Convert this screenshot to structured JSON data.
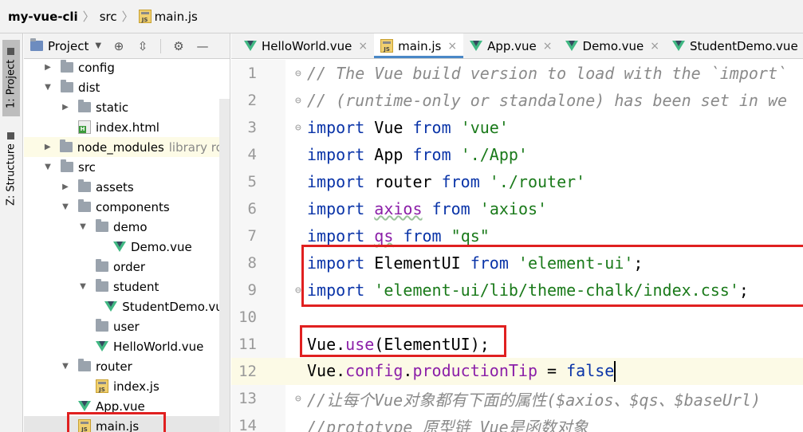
{
  "breadcrumb": {
    "project": "my-vue-cli",
    "folder": "src",
    "file": "main.js"
  },
  "toolstrip": {
    "project_tab": "1: Project",
    "structure_tab": "Z: Structure"
  },
  "project_panel": {
    "title": "Project",
    "tree": [
      {
        "label": "config",
        "type": "folder",
        "state": "collapsed",
        "depth": 0
      },
      {
        "label": "dist",
        "type": "folder",
        "state": "expanded",
        "depth": 0
      },
      {
        "label": "static",
        "type": "folder",
        "state": "collapsed",
        "depth": 1
      },
      {
        "label": "index.html",
        "type": "html",
        "state": "none",
        "depth": 1
      },
      {
        "label": "node_modules",
        "note": "library roo",
        "type": "folder",
        "state": "collapsed",
        "depth": 0,
        "highlight": true
      },
      {
        "label": "src",
        "type": "folder",
        "state": "expanded",
        "depth": 0
      },
      {
        "label": "assets",
        "type": "folder",
        "state": "collapsed",
        "depth": 1
      },
      {
        "label": "components",
        "type": "folder",
        "state": "expanded",
        "depth": 1
      },
      {
        "label": "demo",
        "type": "folder",
        "state": "expanded",
        "depth": 2
      },
      {
        "label": "Demo.vue",
        "type": "vue",
        "state": "none",
        "depth": 3
      },
      {
        "label": "order",
        "type": "folder",
        "state": "none",
        "depth": 2
      },
      {
        "label": "student",
        "type": "folder",
        "state": "expanded",
        "depth": 2
      },
      {
        "label": "StudentDemo.vue",
        "type": "vue",
        "state": "none",
        "depth": 3
      },
      {
        "label": "user",
        "type": "folder",
        "state": "none",
        "depth": 2
      },
      {
        "label": "HelloWorld.vue",
        "type": "vue",
        "state": "none",
        "depth": 2
      },
      {
        "label": "router",
        "type": "folder",
        "state": "expanded",
        "depth": 1
      },
      {
        "label": "index.js",
        "type": "js",
        "state": "none",
        "depth": 2
      },
      {
        "label": "App.vue",
        "type": "vue",
        "state": "none",
        "depth": 1
      },
      {
        "label": "main.js",
        "type": "js",
        "state": "none",
        "depth": 1,
        "selected": true
      }
    ]
  },
  "tabs": [
    {
      "label": "HelloWorld.vue",
      "type": "vue",
      "active": false,
      "closable": true
    },
    {
      "label": "main.js",
      "type": "js",
      "active": true,
      "closable": true
    },
    {
      "label": "App.vue",
      "type": "vue",
      "active": false,
      "closable": true
    },
    {
      "label": "Demo.vue",
      "type": "vue",
      "active": false,
      "closable": true
    },
    {
      "label": "StudentDemo.vue",
      "type": "vue",
      "active": false,
      "closable": false
    }
  ],
  "editor": {
    "lines": [
      {
        "n": "1",
        "fold": true,
        "tokens": [
          [
            "cm",
            "// The Vue build version to load with the `import`"
          ]
        ]
      },
      {
        "n": "2",
        "fold": true,
        "tokens": [
          [
            "cm",
            "// (runtime-only or standalone) has been set in we"
          ]
        ]
      },
      {
        "n": "3",
        "fold": true,
        "tokens": [
          [
            "kw",
            "import"
          ],
          [
            "",
            " Vue "
          ],
          [
            "kw",
            "from"
          ],
          [
            "",
            " "
          ],
          [
            "str",
            "'vue'"
          ]
        ]
      },
      {
        "n": "4",
        "fold": false,
        "tokens": [
          [
            "kw",
            "import"
          ],
          [
            "",
            " App "
          ],
          [
            "kw",
            "from"
          ],
          [
            "",
            " "
          ],
          [
            "str",
            "'./App'"
          ]
        ]
      },
      {
        "n": "5",
        "fold": false,
        "tokens": [
          [
            "kw",
            "import"
          ],
          [
            "",
            " router "
          ],
          [
            "kw",
            "from"
          ],
          [
            "",
            " "
          ],
          [
            "str",
            "'./router'"
          ]
        ]
      },
      {
        "n": "6",
        "fold": false,
        "tokens": [
          [
            "kw",
            "import"
          ],
          [
            "",
            " "
          ],
          [
            "fn wavy",
            "axios"
          ],
          [
            "",
            " "
          ],
          [
            "kw",
            "from"
          ],
          [
            "",
            " "
          ],
          [
            "str",
            "'axios'"
          ]
        ]
      },
      {
        "n": "7",
        "fold": false,
        "tokens": [
          [
            "kw",
            "import"
          ],
          [
            "",
            " "
          ],
          [
            "fn wavy",
            "qs"
          ],
          [
            "",
            " "
          ],
          [
            "kw",
            "from"
          ],
          [
            "",
            " "
          ],
          [
            "str",
            "\"qs\""
          ]
        ]
      },
      {
        "n": "8",
        "fold": false,
        "tokens": [
          [
            "kw",
            "import"
          ],
          [
            "",
            " ElementUI "
          ],
          [
            "kw",
            "from"
          ],
          [
            "",
            " "
          ],
          [
            "str",
            "'element-ui'"
          ],
          [
            "",
            ";"
          ]
        ]
      },
      {
        "n": "9",
        "fold": true,
        "tokens": [
          [
            "kw",
            "import"
          ],
          [
            "",
            " "
          ],
          [
            "str",
            "'element-ui/lib/theme-chalk/index.css'"
          ],
          [
            "",
            ";"
          ]
        ]
      },
      {
        "n": "10",
        "fold": false,
        "tokens": []
      },
      {
        "n": "11",
        "fold": false,
        "tokens": [
          [
            "",
            "Vue."
          ],
          [
            "fn",
            "use"
          ],
          [
            "",
            "(ElementUI);"
          ]
        ]
      },
      {
        "n": "12",
        "fold": false,
        "current": true,
        "tokens": [
          [
            "",
            "Vue."
          ],
          [
            "fn",
            "config"
          ],
          [
            "",
            "."
          ],
          [
            "fn",
            "productionTip"
          ],
          [
            "",
            " = "
          ],
          [
            "kw",
            "false"
          ]
        ]
      },
      {
        "n": "13",
        "fold": true,
        "tokens": [
          [
            "cm",
            "//让每个Vue对象都有下面的属性($axios、$qs、$baseUrl)"
          ]
        ]
      },
      {
        "n": "14",
        "fold": false,
        "tokens": [
          [
            "cm",
            "//prototype 原型链 Vue是函数对象"
          ]
        ]
      }
    ]
  }
}
